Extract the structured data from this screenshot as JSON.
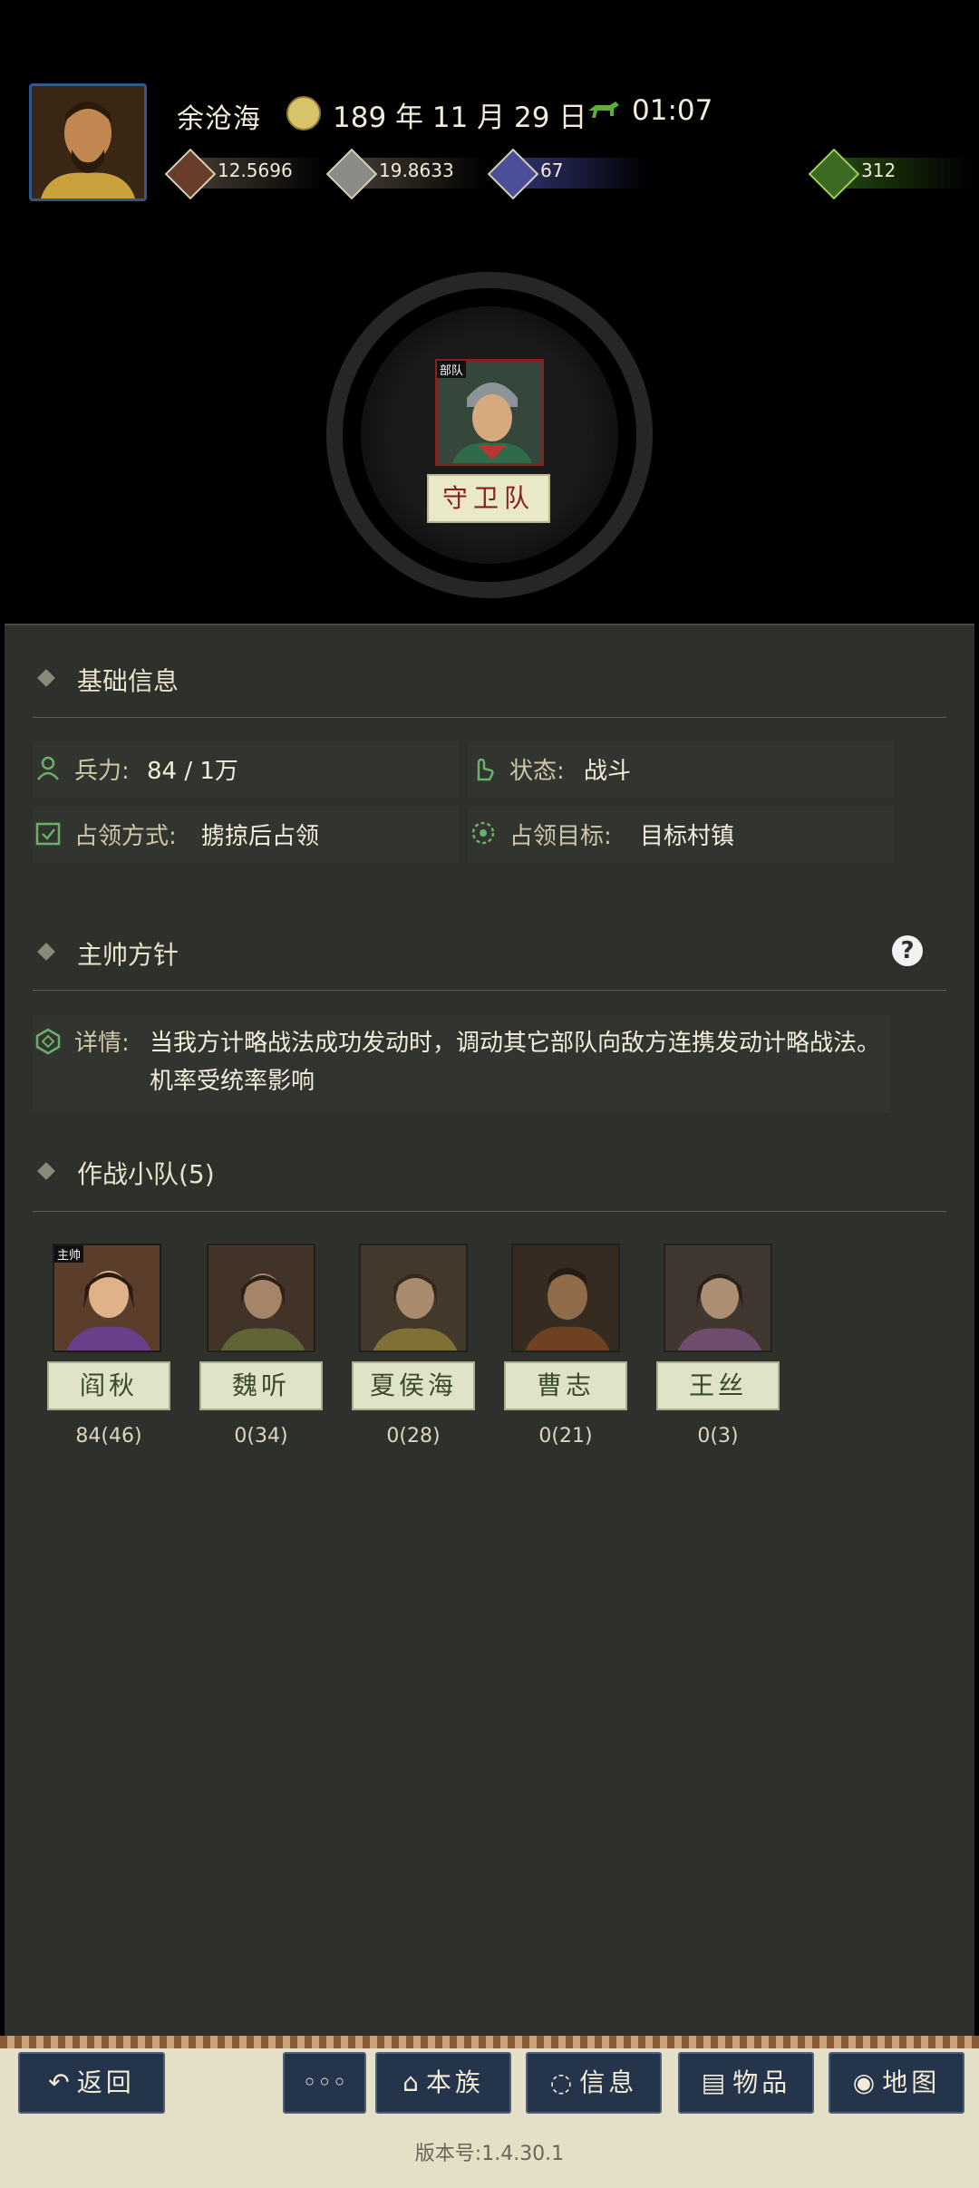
{
  "player": {
    "name": "余沧海",
    "date": "189 年 11 月 29 日",
    "time": "01:07"
  },
  "resources": [
    {
      "icon": "money-icon",
      "value": "12.5696"
    },
    {
      "icon": "food-icon",
      "value": "19.8633"
    },
    {
      "icon": "troops-icon",
      "value": "67"
    },
    {
      "icon": "bag-icon",
      "value": "312"
    }
  ],
  "unit": {
    "tag": "部队",
    "name": "守卫队"
  },
  "basic_info": {
    "title": "基础信息",
    "troops_label": "兵力:",
    "troops_value": "84 / 1万",
    "status_label": "状态:",
    "status_value": "战斗",
    "occupy_mode_label": "占领方式:",
    "occupy_mode_value": "掳掠后占领",
    "occupy_target_label": "占领目标:",
    "occupy_target_value": "目标村镇"
  },
  "policy": {
    "title": "主帅方针",
    "help": "?",
    "detail_label": "详情:",
    "detail_text": "当我方计略战法成功发动时，调动其它部队向敌方连携发动计略战法。机率受统率影响"
  },
  "squad": {
    "title": "作战小队(5)",
    "leader_tag": "主帅",
    "members": [
      {
        "name": "阎秋",
        "count": "84(46)"
      },
      {
        "name": "魏听",
        "count": "0(34)"
      },
      {
        "name": "夏侯海",
        "count": "0(28)"
      },
      {
        "name": "曹志",
        "count": "0(21)"
      },
      {
        "name": "王丝",
        "count": "0(3)"
      }
    ]
  },
  "bottom": {
    "back": "返回",
    "more": "◦◦◦",
    "clan": "本族",
    "info": "信息",
    "items": "物品",
    "map": "地图",
    "version": "版本号:1.4.30.1"
  },
  "colors": {
    "panel": "#2e302b",
    "button": "#24344a",
    "unit_name_text": "#8c1d18"
  }
}
